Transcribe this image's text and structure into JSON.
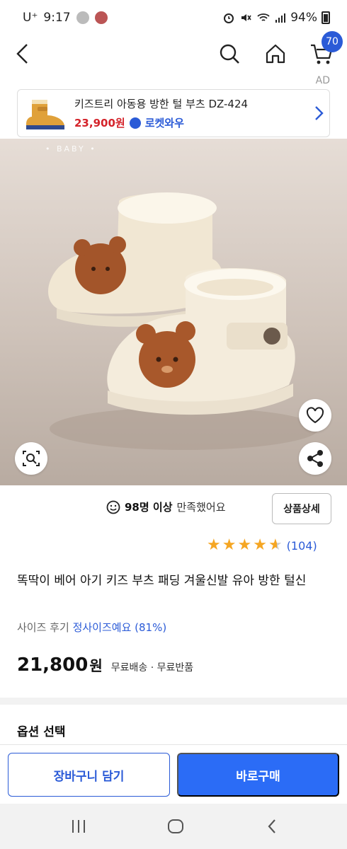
{
  "status_bar": {
    "carrier": "U⁺",
    "time": "9:17",
    "battery": "94%"
  },
  "nav": {
    "cart_count": "70",
    "ad_label": "AD"
  },
  "ad_banner": {
    "title": "키즈트리 아동용 방한 털 부츠 DZ-424",
    "price": "23,900원",
    "badge": "로켓와우"
  },
  "hero": {
    "tag": "• BABY •"
  },
  "satisfaction": {
    "count": "98명 이상",
    "suffix": "만족했어요"
  },
  "detail_button": "상품상세",
  "rating": {
    "stars": 4.5,
    "count": "(104)"
  },
  "product": {
    "title": "똑딱이 베어 아기 키즈 부츠 패딩 겨울신발 유아 방한 털신",
    "size_review_label": "사이즈 후기",
    "size_review_value": "정사이즈예요 (81%)",
    "price": "21,800",
    "price_unit": "원",
    "shipping": "무료배송 · 무료반품"
  },
  "options": {
    "label": "옵션 선택"
  },
  "actions": {
    "cart": "장바구니 담기",
    "buy": "바로구매"
  },
  "colors": {
    "primary": "#2b6cf6",
    "price_red": "#d4232a",
    "star": "#f5a623"
  }
}
